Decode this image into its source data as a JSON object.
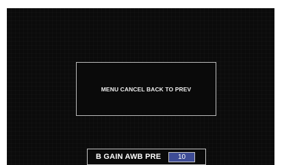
{
  "message": {
    "text": "MENU CANCEL BACK TO PREV"
  },
  "status": {
    "label": "B GAIN AWB PRE",
    "value": "10",
    "value_bg_color": "#3e4c95"
  }
}
